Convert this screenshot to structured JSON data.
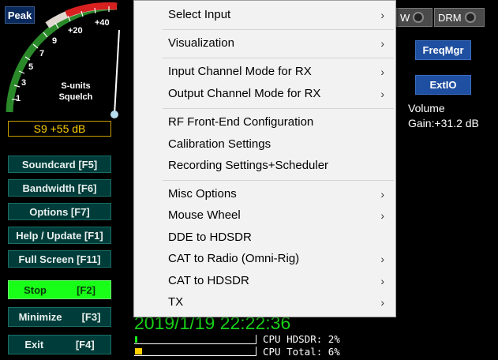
{
  "meter": {
    "peak_label": "Peak",
    "scale_labels": [
      "1",
      "3",
      "5",
      "7",
      "9",
      "+20",
      "+40"
    ],
    "caption_line1": "S-units",
    "caption_line2": "Squelch",
    "readout": "S9 +55 dB",
    "s_unit_level": 0.88
  },
  "left_buttons": {
    "soundcard": "Soundcard  [F5]",
    "bandwidth": "Bandwidth  [F6]",
    "options": "Options  [F7]",
    "help": "Help / Update  [F1]",
    "fullscreen": "Full Screen  [F11]",
    "stop_label": "Stop",
    "stop_key": "[F2]",
    "minimize_label": "Minimize",
    "minimize_key": "[F3]",
    "exit_label": "Exit",
    "exit_key": "[F4]"
  },
  "right": {
    "toggle_w": "W",
    "toggle_drm": "DRM",
    "freqmgr": "FreqMgr",
    "extio": "ExtIO",
    "volume_label": "Volume",
    "gain": "Gain:+31.2 dB"
  },
  "status": {
    "datetime": "2019/1/19 22:22:36",
    "cpu_hdsdr": "CPU HDSDR: 2%",
    "cpu_total": "CPU Total: 6%",
    "cpu_hdsdr_value": 0.02,
    "cpu_total_value": 0.06
  },
  "menu": {
    "items": [
      {
        "label": "Select Input",
        "submenu": true
      },
      {
        "label": "Visualization",
        "submenu": true
      },
      {
        "label": "Input Channel Mode for RX",
        "submenu": true
      },
      {
        "label": "Output Channel Mode for RX",
        "submenu": true
      },
      {
        "label": "RF Front-End Configuration",
        "submenu": false
      },
      {
        "label": "Calibration Settings",
        "submenu": false
      },
      {
        "label": "Recording Settings+Scheduler",
        "submenu": false
      },
      {
        "label": "Misc Options",
        "submenu": true
      },
      {
        "label": "Mouse Wheel",
        "submenu": true
      },
      {
        "label": "DDE to HDSDR",
        "submenu": false
      },
      {
        "label": "CAT to Radio (Omni-Rig)",
        "submenu": true
      },
      {
        "label": "CAT to HDSDR",
        "submenu": true
      },
      {
        "label": "TX",
        "submenu": true
      }
    ],
    "arrow_glyph": "›"
  },
  "colors": {
    "cpu_hdsdr_bar": "#18ff18",
    "cpu_total_bar": "#ffd000",
    "stop_button": "#18ff18"
  }
}
